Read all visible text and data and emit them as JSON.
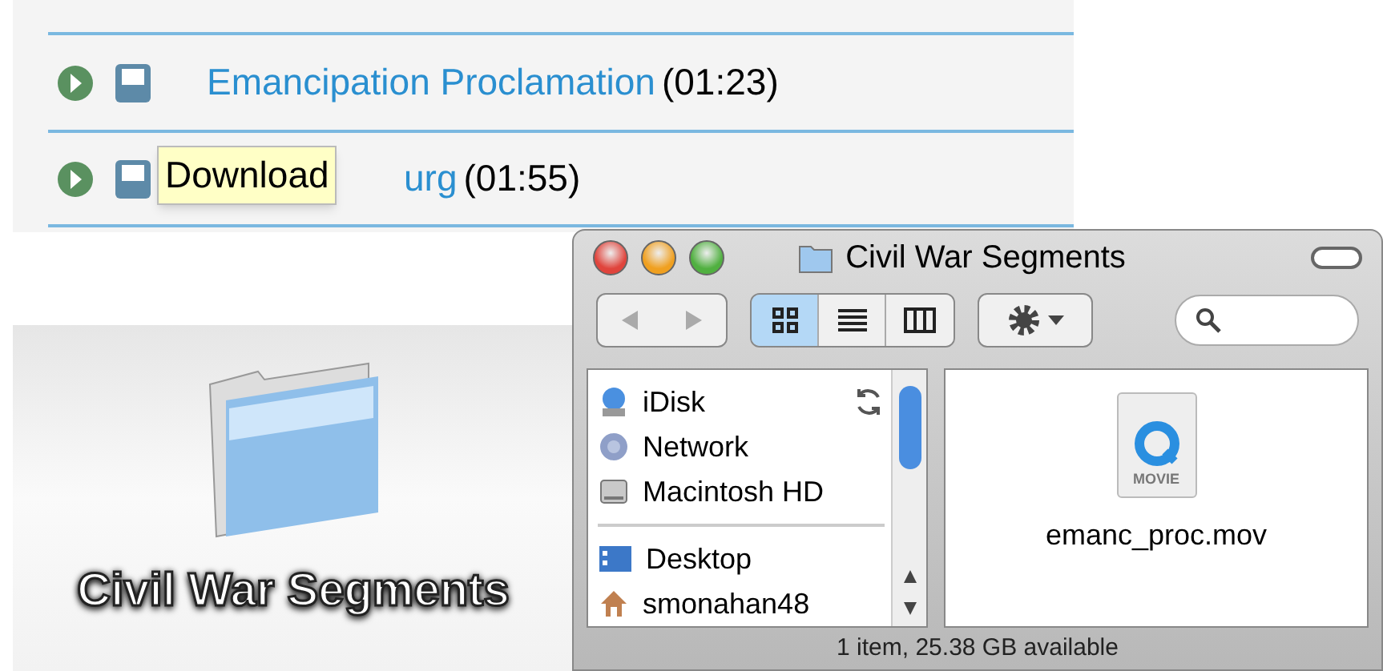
{
  "clip_list": {
    "rows": [
      {
        "title": "Emancipation Proclamation",
        "duration": "(01:23)"
      },
      {
        "title": "urg",
        "duration": "(01:55)"
      }
    ],
    "tooltip": "Download"
  },
  "desktop_folder": {
    "label": "Civil War Segments"
  },
  "finder": {
    "window": {
      "title": "Civil War Segments"
    },
    "view_buttons": [
      {
        "kind": "icon",
        "selected": true
      },
      {
        "kind": "list",
        "selected": false
      },
      {
        "kind": "column",
        "selected": false
      }
    ],
    "sidebar": {
      "devices": [
        {
          "label": "iDisk",
          "kind": "idisk",
          "syncing": true
        },
        {
          "label": "Network",
          "kind": "network",
          "syncing": false
        },
        {
          "label": "Macintosh HD",
          "kind": "drive",
          "syncing": false
        }
      ],
      "places": [
        {
          "label": "Desktop",
          "kind": "desktop",
          "syncing": false
        },
        {
          "label": "smonahan48",
          "kind": "home",
          "syncing": false
        }
      ]
    },
    "files": [
      {
        "name": "emanc_proc.mov",
        "badge": "MOVIE"
      }
    ],
    "status_bar": "1 item, 25.38 GB available"
  }
}
